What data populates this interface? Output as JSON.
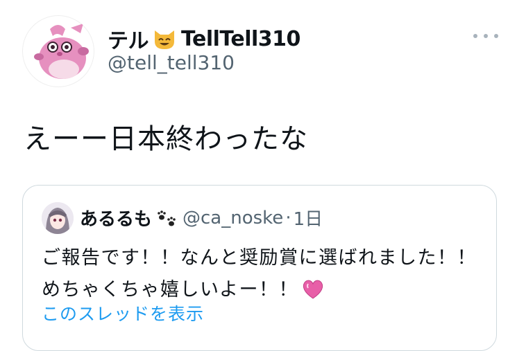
{
  "tweet": {
    "author": {
      "display_name_part1": "テル",
      "display_name_emoji": "cat-smile-emoji",
      "display_name_part2": "TellTell310",
      "handle": "@tell_tell310",
      "avatar_icon": "pink-pokemon-avatar"
    },
    "more_icon": "ellipsis-icon",
    "text": "えーー日本終わったな"
  },
  "quote": {
    "author": {
      "display_name": "あるるも",
      "name_emoji": "paw-prints-emoji",
      "handle": "@ca_noske",
      "avatar_icon": "anime-girl-avatar"
    },
    "separator": "·",
    "time": "1日",
    "body_lines": [
      "ご報告です！！なんと奨励賞に選ばれました！！",
      "めちゃくちゃ嬉しいよー！！"
    ],
    "body_emoji": "sparkling-heart-emoji",
    "thread_link": "このスレッドを表示"
  },
  "colors": {
    "text": "#0f1419",
    "secondary": "#536471",
    "link": "#1d9bf0",
    "border": "#cfd9de",
    "heart": "#e85fa8"
  }
}
